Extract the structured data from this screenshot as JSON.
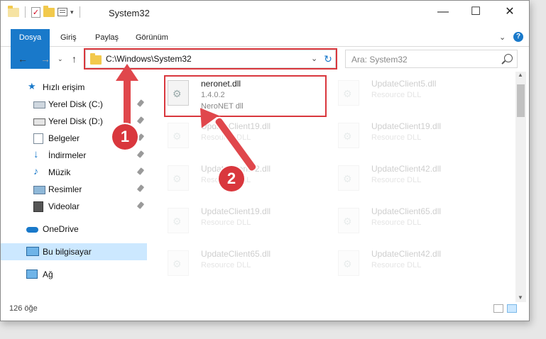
{
  "window": {
    "title": "System32"
  },
  "ribbon": {
    "tabs": [
      {
        "label": "Dosya"
      },
      {
        "label": "Giriş"
      },
      {
        "label": "Paylaş"
      },
      {
        "label": "Görünüm"
      }
    ]
  },
  "address": {
    "path": "C:\\Windows\\System32",
    "search_placeholder": "Ara: System32"
  },
  "sidebar": {
    "quick_access": "Hızlı erişim",
    "items": [
      {
        "label": "Yerel Disk (C:)"
      },
      {
        "label": "Yerel Disk (D:)"
      },
      {
        "label": "Belgeler"
      },
      {
        "label": "İndirmeler"
      },
      {
        "label": "Müzik"
      },
      {
        "label": "Resimler"
      },
      {
        "label": "Videolar"
      }
    ],
    "onedrive": "OneDrive",
    "this_pc": "Bu bilgisayar",
    "network": "Ağ"
  },
  "files": [
    {
      "name": "neronet.dll",
      "line2": "1.4.0.2",
      "line3": "NeroNET dll"
    },
    {
      "name": "UpdateClient5.dll",
      "line2": "Resource DLL"
    },
    {
      "name": "UpdateClient19.dll",
      "line2": "Resource DLL"
    },
    {
      "name": "UpdateClient19.dll",
      "line2": "Resource DLL"
    },
    {
      "name": "UpdateClient42.dll",
      "line2": "Resource DLL"
    },
    {
      "name": "UpdateClient42.dll",
      "line2": "Resource DLL"
    },
    {
      "name": "UpdateClient19.dll",
      "line2": "Resource DLL"
    },
    {
      "name": "UpdateClient65.dll",
      "line2": "Resource DLL"
    },
    {
      "name": "UpdateClient65.dll",
      "line2": "Resource DLL"
    },
    {
      "name": "UpdateClient42.dll",
      "line2": "Resource DLL"
    }
  ],
  "status": {
    "count": "126 öğe"
  },
  "annotations": {
    "step1": "1",
    "step2": "2",
    "color": "#d9373d"
  }
}
